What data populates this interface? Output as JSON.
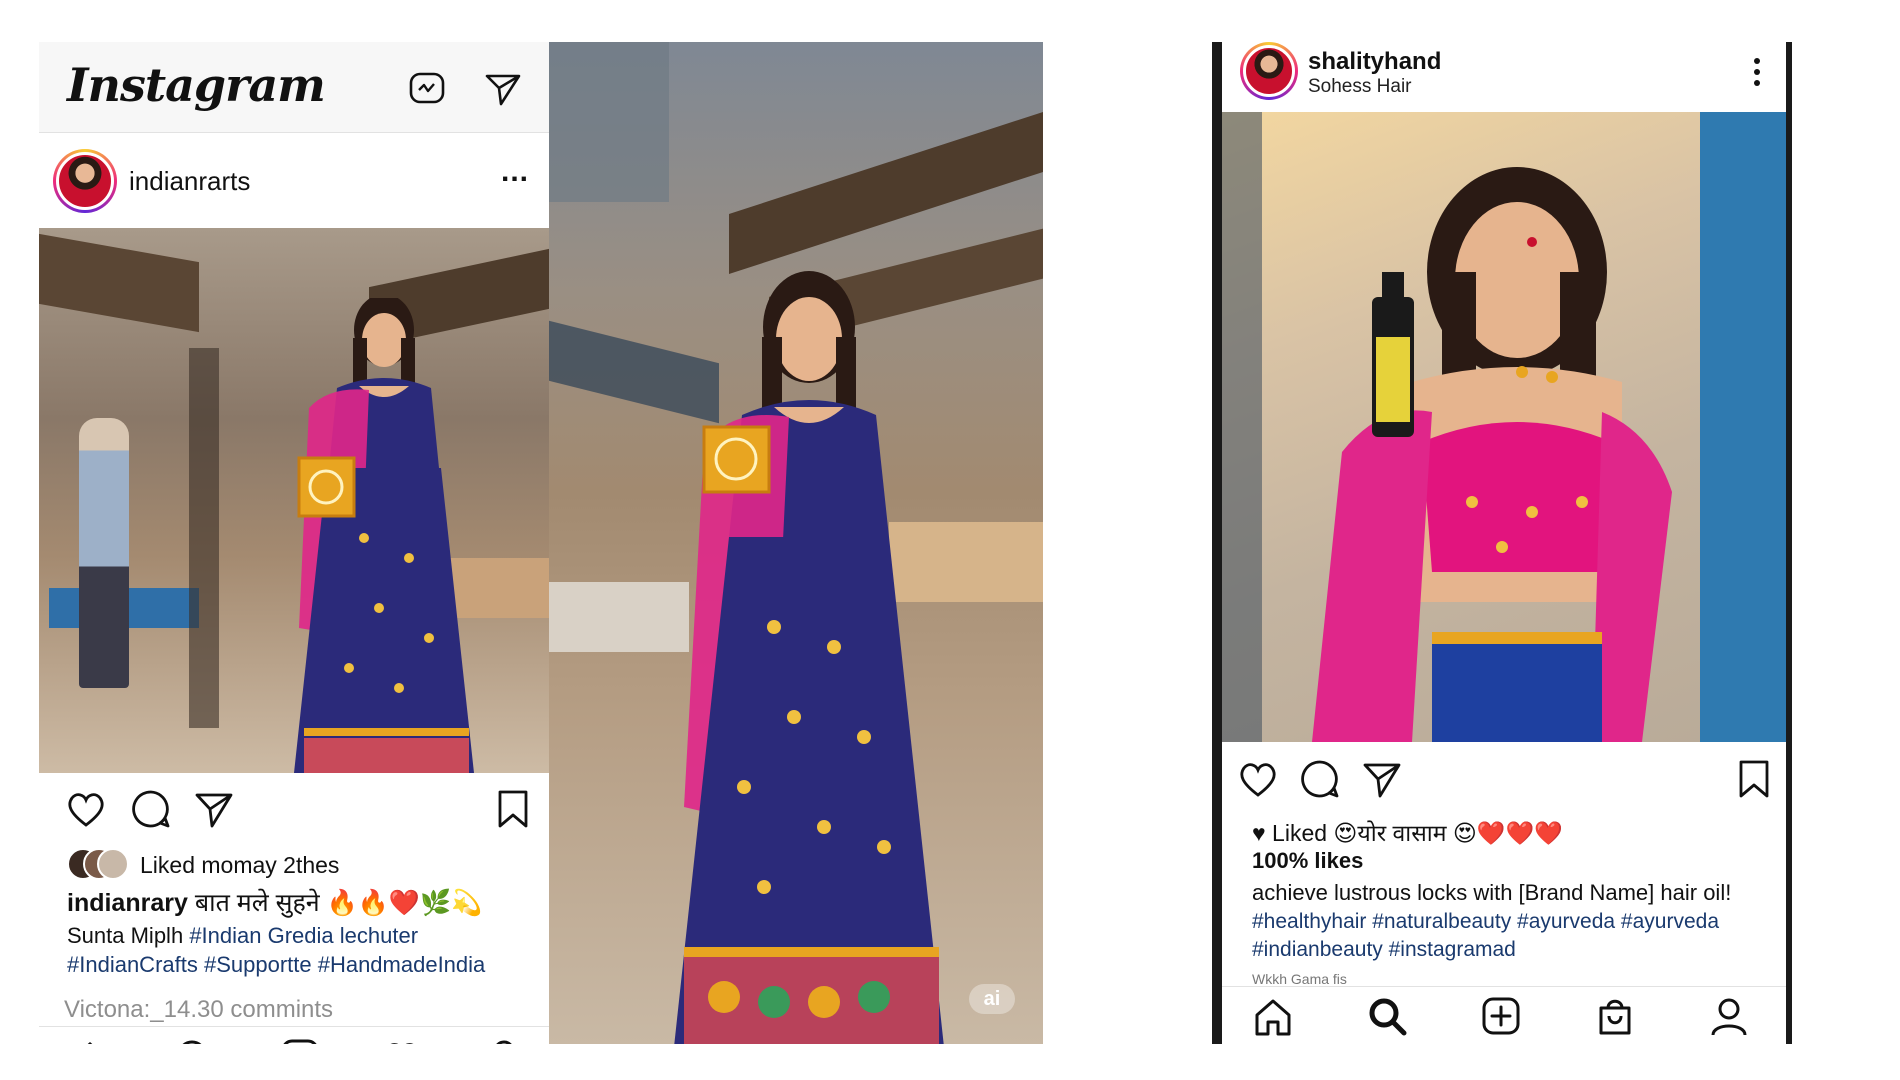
{
  "left_post": {
    "app_logo": "Instagram",
    "username": "indianrarts",
    "more": "...",
    "liked_by": "Liked momay 2thes",
    "caption_user": "indianrary",
    "caption_text": "बात मले सुहने 🔥🔥❤️🌿💫",
    "caption_line2_prefix": "Sunta Miplh",
    "caption_line2_tag": "#Indian Gredia lechuter",
    "caption_line3": "#IndianCrafts #Supportte #HandmadeIndia",
    "comments": "Victona:_14.30 commints",
    "icons": [
      "reels-icon",
      "send-icon",
      "heart-icon",
      "comment-icon",
      "share-icon",
      "bookmark-icon",
      "home-icon",
      "search-icon",
      "add-icon",
      "activity-icon",
      "profile-icon"
    ]
  },
  "middle_photo": {
    "watermark": "ai"
  },
  "right_post": {
    "username": "shalityhand",
    "subtitle": "Sohess Hair",
    "liked_line": "Liked 😍योर वासाम 😍❤️❤️❤️",
    "likes_count": "100% likes",
    "caption_line1": "achieve lustrous locks with [Brand Name] hair oil!",
    "caption_line2": "#healthyhair #naturalbeauty #ayurveda #ayurveda",
    "caption_line3": "#indianbeauty #instagramad",
    "cut_line": "Wkkh Gama fis",
    "icons": [
      "heart-icon",
      "comment-icon",
      "share-icon",
      "bookmark-icon",
      "home-icon",
      "search-icon",
      "add-icon",
      "shop-icon",
      "profile-icon"
    ]
  },
  "colors": {
    "hashtag": "#1a3a6e",
    "lehenga_navy": "#2b2a7a",
    "dupatta_pink": "#e0268a",
    "gold": "#e8a521"
  }
}
